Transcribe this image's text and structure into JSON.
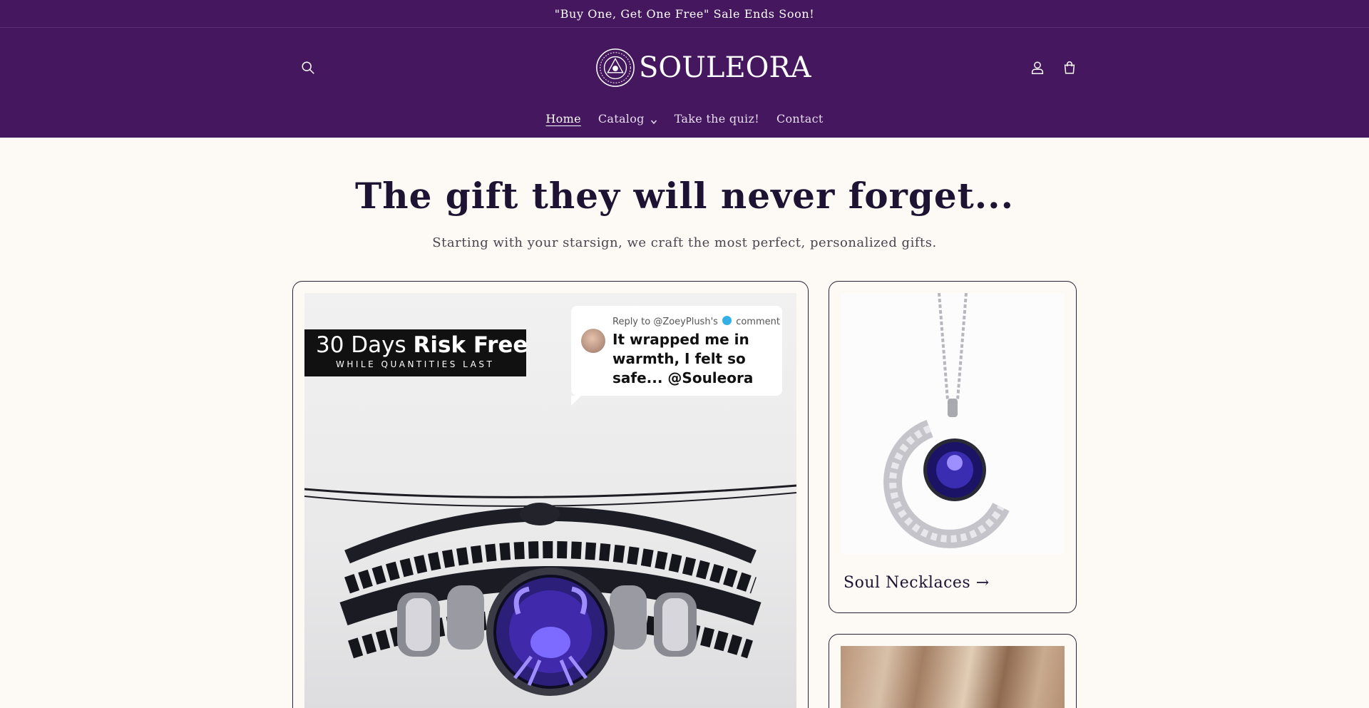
{
  "announcement": {
    "text": "\"Buy One, Get One Free\" Sale Ends Soon!"
  },
  "header": {
    "brand_name": "SOULEORA",
    "icons": {
      "search": "search-icon",
      "account": "account-icon",
      "cart": "cart-icon"
    }
  },
  "nav": {
    "items": [
      {
        "label": "Home",
        "active": true
      },
      {
        "label": "Catalog",
        "has_dropdown": true
      },
      {
        "label": "Take the quiz!"
      },
      {
        "label": "Contact"
      }
    ]
  },
  "hero": {
    "title": "The gift they will never forget...",
    "subtitle": "Starting with your starsign, we craft the most perfect, personalized gifts."
  },
  "featured_card": {
    "badge_main": "30 Days",
    "badge_bold": "Risk Free",
    "badge_sub": "WHILE QUANTITIES LAST",
    "comment_header_prefix": "Reply to @ZoeyPlush's",
    "comment_header_suffix": "comment",
    "comment_text": "It wrapped me in warmth, I felt so safe... @Souleora"
  },
  "collection_cards": [
    {
      "label": "Soul Necklaces →"
    }
  ],
  "colors": {
    "brand_purple": "#45175f",
    "page_background": "#fdfaf5",
    "text_dark": "#1f1333"
  }
}
